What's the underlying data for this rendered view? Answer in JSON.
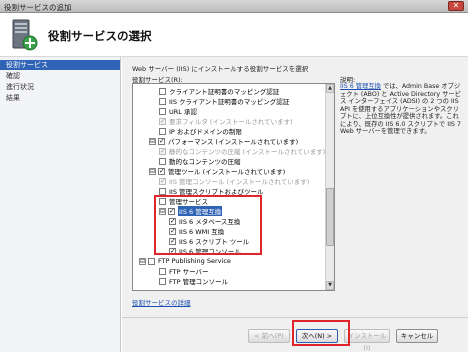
{
  "window": {
    "title": "役割サービスの追加",
    "close_glyph": "✕"
  },
  "header": {
    "title": "役割サービスの選択",
    "icon": "server-install-icon"
  },
  "sidebar": {
    "items": [
      {
        "label": "役割サービス",
        "active": true
      },
      {
        "label": "確認",
        "active": false
      },
      {
        "label": "進行状況",
        "active": false
      },
      {
        "label": "結果",
        "active": false
      }
    ]
  },
  "main": {
    "intro": "Web サーバー (IIS) にインストールする役割サービスを選択",
    "list_label": "役割サービス(R):",
    "description_label": "説明:",
    "details_link": "役割サービスの詳細",
    "tree": [
      {
        "label": "クライアント証明書のマッピング認証",
        "checked": false,
        "disabled": false
      },
      {
        "label": "IIS クライアント証明書のマッピング認証",
        "checked": false,
        "disabled": false
      },
      {
        "label": "URL 承認",
        "checked": false,
        "disabled": false
      },
      {
        "label": "要求フィルタ (インストールされています)",
        "checked": true,
        "disabled": true
      },
      {
        "label": "IP およびドメインの制限",
        "checked": false,
        "disabled": false
      },
      {
        "label": "パフォーマンス (インストールされています)",
        "checked": true,
        "disabled": false,
        "expander": "⊟"
      },
      {
        "label": "静的なコンテンツの圧縮 (インストールされています)",
        "checked": true,
        "disabled": true
      },
      {
        "label": "動的なコンテンツの圧縮",
        "checked": false,
        "disabled": false
      },
      {
        "label": "管理ツール (インストールされています)",
        "checked": true,
        "disabled": false,
        "expander": "⊟"
      },
      {
        "label": "IIS 管理コンソール (インストールされています)",
        "checked": true,
        "disabled": true
      },
      {
        "label": "IIS 管理スクリプトおよびツール",
        "checked": false,
        "disabled": false
      },
      {
        "label": "管理サービス",
        "checked": false,
        "disabled": false
      },
      {
        "label": "IIS 6 管理互換",
        "checked": true,
        "disabled": false,
        "expander": "⊟",
        "selected": true
      },
      {
        "label": "IIS 6 メタベース互換",
        "checked": true,
        "disabled": false
      },
      {
        "label": "IIS 6 WMI 互換",
        "checked": true,
        "disabled": false
      },
      {
        "label": "IIS 6 スクリプト ツール",
        "checked": true,
        "disabled": false
      },
      {
        "label": "IIS 6 管理コンソール",
        "checked": true,
        "disabled": false
      },
      {
        "label": "FTP Publishing Service",
        "checked": false,
        "disabled": false,
        "expander": "⊟"
      },
      {
        "label": "FTP サーバー",
        "checked": false,
        "disabled": false
      },
      {
        "label": "FTP 管理コンソール",
        "checked": false,
        "disabled": false
      }
    ],
    "description": {
      "link": "IIS 6 管理互換",
      "text": "では、Admin Base オブジェクト (ABO) と Active Directory サービス インターフェイス (ADSI) の 2 つの IIS API を使用するアプリケーションやスクリプトに、上位互換性が提供されます。これにより、既存の IIS 6.0 スクリプトで IIS 7 Web サーバーを管理できます。"
    }
  },
  "footer": {
    "prev": "< 前へ(P)",
    "next": "次へ(N) >",
    "install": "インストール(I)",
    "cancel": "キャンセル"
  },
  "colors": {
    "selection": "#2f63b5",
    "highlight": "#e0242a",
    "link": "#1a4fb0"
  }
}
